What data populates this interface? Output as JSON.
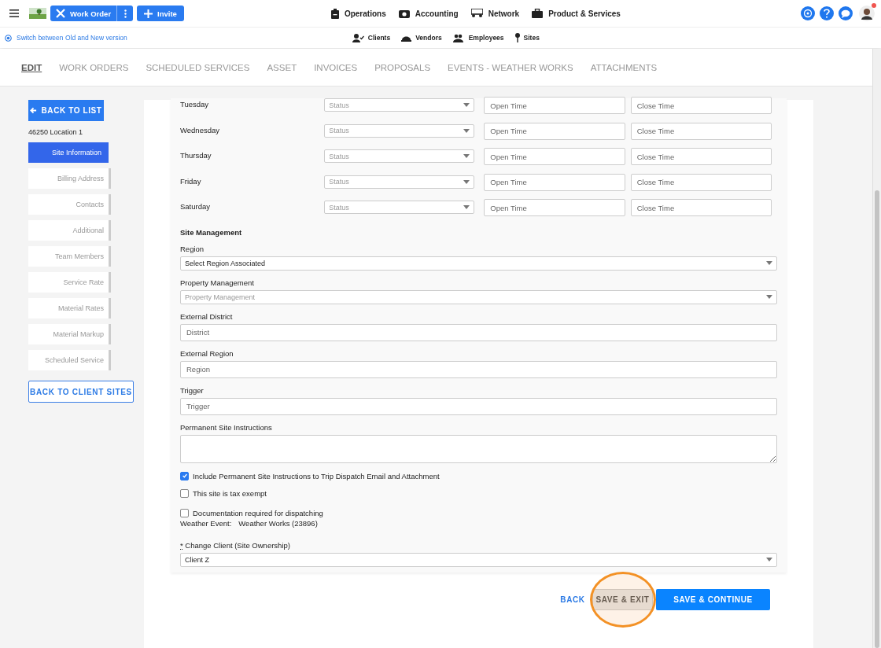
{
  "top_bar": {
    "work_order_button": "Work Order",
    "invite_button": "Invite",
    "nav": [
      {
        "label": "Operations"
      },
      {
        "label": "Accounting"
      },
      {
        "label": "Network"
      },
      {
        "label": "Product & Services"
      }
    ],
    "has_notification": true
  },
  "sub_bar": {
    "version_toggle": "Switch between Old and New version",
    "links": [
      {
        "label": "Clients"
      },
      {
        "label": "Vendors"
      },
      {
        "label": "Employees"
      },
      {
        "label": "Sites"
      }
    ]
  },
  "tabs": [
    {
      "label": "EDIT",
      "selected": true
    },
    {
      "label": "WORK ORDERS",
      "selected": false
    },
    {
      "label": "SCHEDULED SERVICES",
      "selected": false
    },
    {
      "label": "ASSET",
      "selected": false
    },
    {
      "label": "INVOICES",
      "selected": false
    },
    {
      "label": "PROPOSALS",
      "selected": false
    },
    {
      "label": "EVENTS - WEATHER WORKS",
      "selected": false
    },
    {
      "label": "ATTACHMENTS",
      "selected": false
    }
  ],
  "sidebar": {
    "back_button": "BACK TO LIST",
    "location": "46250 Location 1",
    "items": [
      {
        "label": "Site Information",
        "selected": true
      },
      {
        "label": "Billing Address",
        "selected": false
      },
      {
        "label": "Contacts",
        "selected": false
      },
      {
        "label": "Additional",
        "selected": false
      },
      {
        "label": "Team Members",
        "selected": false
      },
      {
        "label": "Service Rate",
        "selected": false
      },
      {
        "label": "Material Rates",
        "selected": false
      },
      {
        "label": "Material Markup",
        "selected": false
      },
      {
        "label": "Scheduled Service",
        "selected": false
      }
    ],
    "back_to_sites": "BACK TO CLIENT SITES"
  },
  "schedule": [
    {
      "day": "Tuesday",
      "status_placeholder": "Status",
      "open_placeholder": "Open Time",
      "close_placeholder": "Close Time"
    },
    {
      "day": "Wednesday",
      "status_placeholder": "Status",
      "open_placeholder": "Open Time",
      "close_placeholder": "Close Time"
    },
    {
      "day": "Thursday",
      "status_placeholder": "Status",
      "open_placeholder": "Open Time",
      "close_placeholder": "Close Time"
    },
    {
      "day": "Friday",
      "status_placeholder": "Status",
      "open_placeholder": "Open Time",
      "close_placeholder": "Close Time"
    },
    {
      "day": "Saturday",
      "status_placeholder": "Status",
      "open_placeholder": "Open Time",
      "close_placeholder": "Close Time"
    }
  ],
  "site_management": {
    "heading": "Site Management",
    "fields": [
      {
        "label": "Region",
        "kind": "select",
        "value": "Select Region Associated"
      },
      {
        "label": "Property Management",
        "kind": "select",
        "placeholder": "Property Management"
      },
      {
        "label": "External District",
        "kind": "input",
        "placeholder": "District"
      },
      {
        "label": "External Region",
        "kind": "input",
        "placeholder": "Region"
      },
      {
        "label": "Trigger",
        "kind": "input",
        "placeholder": "Trigger"
      },
      {
        "label": "Permanent Site Instructions",
        "kind": "textarea"
      }
    ]
  },
  "checkboxes": [
    {
      "label": "Include Permanent Site Instructions to Trip Dispatch Email and Attachment",
      "checked": true
    },
    {
      "label": "This site is tax exempt",
      "checked": false
    },
    {
      "label": "Documentation required for dispatching",
      "checked": false
    }
  ],
  "weather_event": {
    "label": "Weather Event:",
    "value": "Weather Works (23896)"
  },
  "change_client": {
    "required_mark": "*",
    "label": "Change Client (Site Ownership)",
    "value": "Client Z"
  },
  "actions": [
    {
      "label": "BACK",
      "kind": "link"
    },
    {
      "label": "SAVE & EXIT",
      "kind": "secondary",
      "clicked": true
    },
    {
      "label": "SAVE & CONTINUE",
      "kind": "primary"
    }
  ]
}
